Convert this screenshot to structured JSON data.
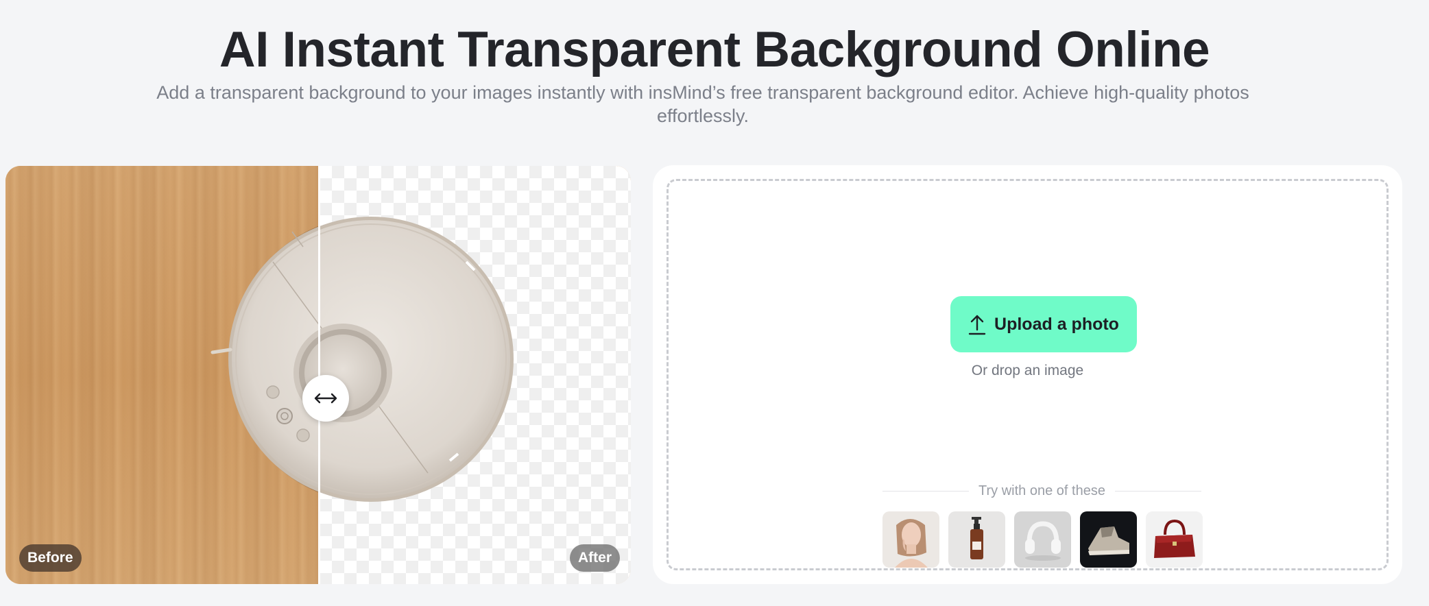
{
  "hero": {
    "title": "AI Instant Transparent Background Online",
    "subtitle": "Add a transparent background to your images instantly with insMind’s free transparent background editor. Achieve high-quality photos effortlessly."
  },
  "compare": {
    "before_label": "Before",
    "after_label": "After",
    "handle_icon": "double-arrow-horizontal-icon",
    "split_position": 0.5
  },
  "upload": {
    "button_label": "Upload a photo",
    "button_icon": "upload-arrow-icon",
    "drop_hint": "Or drop an image",
    "try_label": "Try with one of these",
    "samples": [
      {
        "name": "sample-woman-portrait"
      },
      {
        "name": "sample-pump-bottle"
      },
      {
        "name": "sample-headphones"
      },
      {
        "name": "sample-sneaker"
      },
      {
        "name": "sample-red-handbag"
      }
    ]
  },
  "colors": {
    "page_bg": "#f4f5f7",
    "accent": "#6ffbc8",
    "title": "#24252a",
    "muted": "#7b7f89"
  }
}
